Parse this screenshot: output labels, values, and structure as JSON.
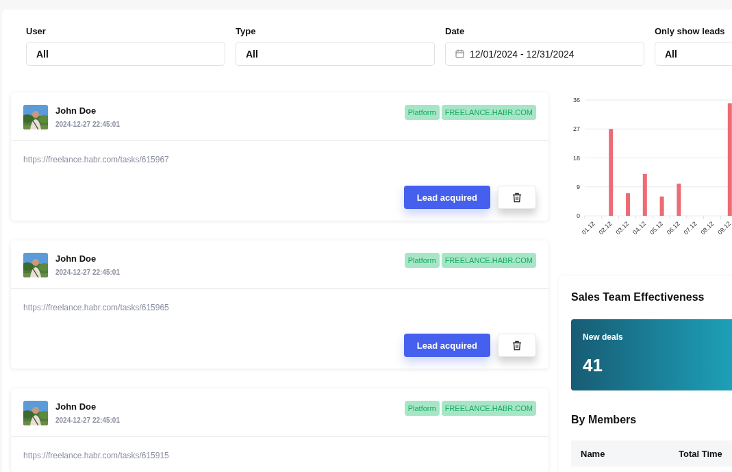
{
  "filters": [
    {
      "label": "User",
      "kind": "select",
      "value": "All"
    },
    {
      "label": "Type",
      "kind": "select",
      "value": "All"
    },
    {
      "label": "Date",
      "kind": "date",
      "value": "12/01/2024 - 12/31/2024"
    },
    {
      "label": "Only show leads",
      "kind": "select",
      "value": "All"
    }
  ],
  "leads": [
    {
      "name": "John Doe",
      "time": "2024-12-27 22:45:01",
      "tags": [
        "Platform",
        "FREELANCE.HABR.COM"
      ],
      "url": "https://freelance.habr.com/tasks/615967",
      "action": "Lead acquired"
    },
    {
      "name": "John Doe",
      "time": "2024-12-27 22:45:01",
      "tags": [
        "Platform",
        "FREELANCE.HABR.COM"
      ],
      "url": "https://freelance.habr.com/tasks/615965",
      "action": "Lead acquired"
    },
    {
      "name": "John Doe",
      "time": "2024-12-27 22:45:01",
      "tags": [
        "Platform",
        "FREELANCE.HABR.COM"
      ],
      "url": "https://freelance.habr.com/tasks/615915"
    }
  ],
  "chart": {
    "chart_data": {
      "type": "bar",
      "categories": [
        "01.12",
        "02.12",
        "03.12",
        "04.12",
        "05.12",
        "06.12",
        "07.12",
        "08.12",
        "09.12"
      ],
      "series": [
        {
          "color": "#ec6b74",
          "values": [
            0,
            27,
            7,
            13,
            6,
            10,
            0,
            0,
            35
          ]
        }
      ],
      "grid": true,
      "ylim": [
        0,
        36
      ],
      "yticks": [
        0,
        9,
        18,
        27,
        36
      ]
    }
  },
  "sales": {
    "title": "Sales Team Effectiveness",
    "stat": {
      "label": "New deals",
      "value": "41"
    },
    "members_title": "By Members",
    "columns": [
      "Name",
      "Total Time"
    ]
  }
}
